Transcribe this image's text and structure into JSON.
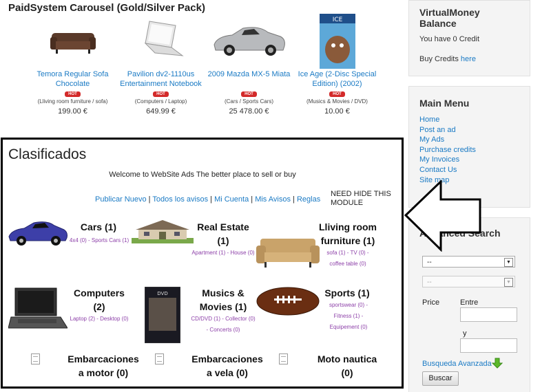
{
  "carousel": {
    "title": "PaidSystem Carousel (Gold/Silver Pack)",
    "hot_label": "HOT",
    "items": [
      {
        "name": "Temora Regular Sofa Chocolate",
        "category": "(Lliving room furniture / sofa)",
        "price": "199.00 €",
        "icon": "sofa-icon"
      },
      {
        "name": "Pavilion dv2-1110us Entertainment Notebook",
        "category": "(Computers / Laptop)",
        "price": "649.99 €",
        "icon": "laptop-icon"
      },
      {
        "name": "2009 Mazda MX-5 Miata",
        "category": "(Cars / Sports Cars)",
        "price": "25 478.00 €",
        "icon": "car-icon"
      },
      {
        "name": "Ice Age (2-Disc Special Edition) (2002)",
        "category": "(Musics & Movies / DVD)",
        "price": "10.00 €",
        "icon": "movie-icon"
      }
    ]
  },
  "sidebar": {
    "balance": {
      "title": "VirtualMoney Balance",
      "credit_text": "You have 0 Credit",
      "buy_text": "Buy Credits ",
      "buy_link": "here"
    },
    "main_menu": {
      "title": "Main Menu",
      "items": [
        "Home",
        "Post an ad",
        "My Ads",
        "Purchase credits",
        "My Invoices",
        "Contact Us",
        "Site map"
      ]
    },
    "advanced_search": {
      "title": "Advanced Search",
      "select1": "--",
      "select2": "--",
      "price_label": "Price",
      "entre_label": "Entre",
      "y_label": "y",
      "busqueda_link": "Busqueda Avanzada",
      "search_button": "Buscar"
    }
  },
  "module": {
    "title": "Clasificados",
    "welcome": "Welcome to WebSite Ads The better place to sell or buy",
    "nav": [
      "Publicar Nuevo",
      "Todos los avisos",
      "Mi Cuenta",
      "Mis Avisos",
      "Reglas"
    ],
    "note": "NEED HIDE THIS MODULE",
    "categories": [
      {
        "title": "Cars (1)",
        "sub": "4x4 (0) - Sports Cars (1)",
        "icon": "car-icon"
      },
      {
        "title": "Real Estate (1)",
        "sub": "Apartment (1) - House (0)",
        "icon": "house-icon"
      },
      {
        "title": "Lliving room furniture (1)",
        "sub": "sofa (1) - TV (0) - coffee table (0)",
        "icon": "sofa-icon"
      },
      {
        "title": "Computers (2)",
        "sub": "Laptop (2) - Desktop (0)",
        "icon": "laptop-icon"
      },
      {
        "title": "Musics & Movies (1)",
        "sub": "CD/DVD (1) - Collector (0) - Concerts (0)",
        "icon": "movie-icon"
      },
      {
        "title": "Sports (1)",
        "sub": "sportswear (0) - Fitness (1) - Equipement (0)",
        "icon": "football-icon"
      },
      {
        "title": "Embarcaciones a motor (0)",
        "icon": "document-icon"
      },
      {
        "title": "Embarcaciones a vela (0)",
        "icon": "document-icon"
      },
      {
        "title": "Moto nautica (0)",
        "icon": "document-icon"
      }
    ]
  },
  "colors": {
    "link": "#1a7ac4",
    "subcategory": "#8c3fa8",
    "hot_badge": "#d32a2a",
    "border": "#000000"
  }
}
